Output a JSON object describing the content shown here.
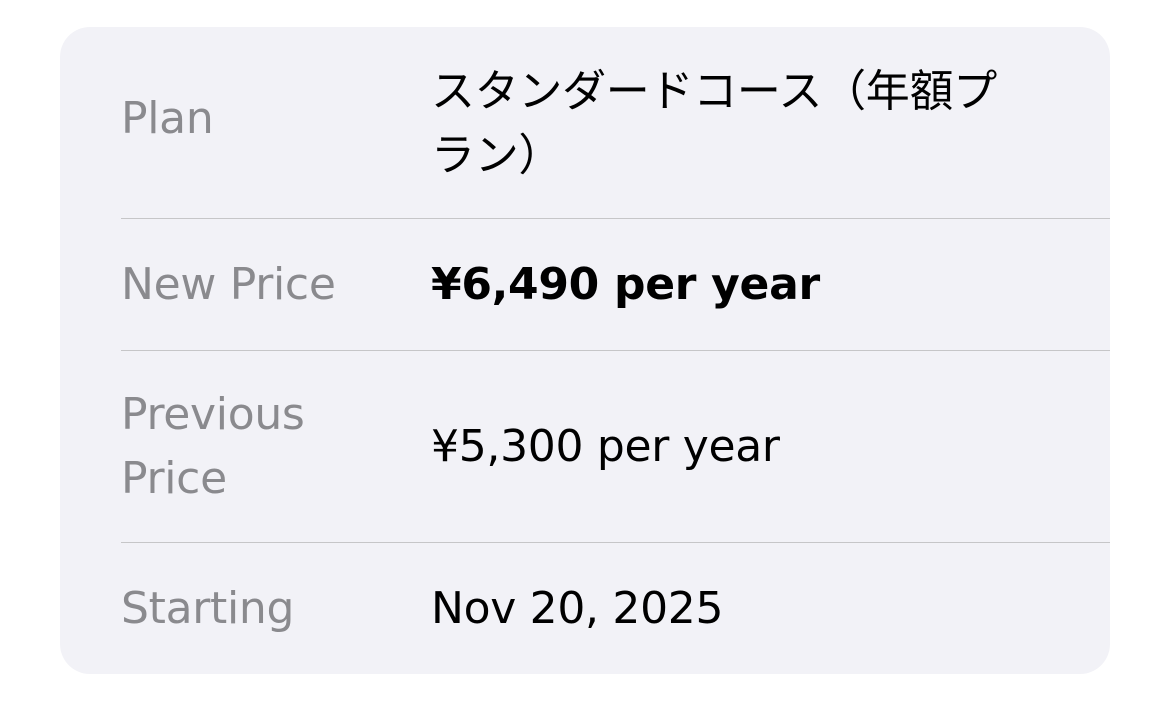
{
  "rows": [
    {
      "label": "Plan",
      "value": "スタンダードコース（年額プラン）"
    },
    {
      "label": "New Price",
      "value": "¥6,490 per year"
    },
    {
      "label": "Previous Price",
      "value": "¥5,300 per year"
    },
    {
      "label": "Starting",
      "value": "Nov 20, 2025"
    }
  ]
}
